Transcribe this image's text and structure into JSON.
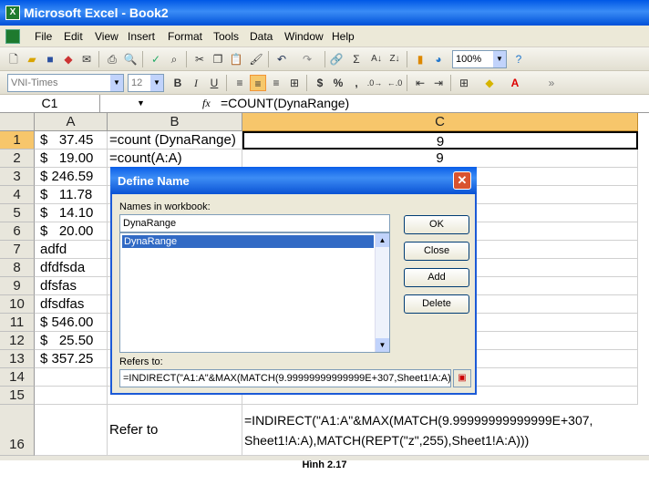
{
  "window": {
    "title": "Microsoft Excel - Book2"
  },
  "menu": [
    "File",
    "Edit",
    "View",
    "Insert",
    "Format",
    "Tools",
    "Data",
    "Window",
    "Help"
  ],
  "toolbar": {
    "zoom": "100%",
    "font": "VNI-Times",
    "font_size": "12",
    "sigma": "Σ",
    "bold": "B",
    "italic": "I",
    "underline": "U",
    "currency": "$",
    "percent": "%",
    "comma": ","
  },
  "formula_bar": {
    "name_box": "C1",
    "fx": "fx",
    "formula": "=COUNT(DynaRange)"
  },
  "columns": [
    "A",
    "B",
    "C"
  ],
  "rows": [
    {
      "n": "1",
      "a": "$   37.45",
      "b": "=count (DynaRange)",
      "c": "9"
    },
    {
      "n": "2",
      "a": "$   19.00",
      "b": "=count(A:A)",
      "c": "9"
    },
    {
      "n": "3",
      "a": "$ 246.59",
      "b": "",
      "c": ""
    },
    {
      "n": "4",
      "a": "$   11.78",
      "b": "",
      "c": ""
    },
    {
      "n": "5",
      "a": "$   14.10",
      "b": "",
      "c": ""
    },
    {
      "n": "6",
      "a": "$   20.00",
      "b": "",
      "c": ""
    },
    {
      "n": "7",
      "a": "adfd",
      "b": "",
      "c": ""
    },
    {
      "n": "8",
      "a": "dfdfsda",
      "b": "",
      "c": ""
    },
    {
      "n": "9",
      "a": "dfsfas",
      "b": "",
      "c": ""
    },
    {
      "n": "10",
      "a": "dfsdfas",
      "b": "",
      "c": ""
    },
    {
      "n": "11",
      "a": "$ 546.00",
      "b": "",
      "c": ""
    },
    {
      "n": "12",
      "a": "$   25.50",
      "b": "",
      "c": ""
    },
    {
      "n": "13",
      "a": "$ 357.25",
      "b": "",
      "c": ""
    },
    {
      "n": "14",
      "a": "",
      "b": "",
      "c": ""
    },
    {
      "n": "15",
      "a": "",
      "b": "",
      "c": ""
    }
  ],
  "row16": {
    "n": "16",
    "b": "Refer to",
    "c_line1": "=INDIRECT(\"A1:A\"&MAX(MATCH(9.99999999999999E+307,",
    "c_line2": "Sheet1!A:A),MATCH(REPT(\"z\",255),Sheet1!A:A)))"
  },
  "dialog": {
    "title": "Define Name",
    "names_label": "Names in workbook:",
    "name_value": "DynaRange",
    "list_items": [
      "DynaRange"
    ],
    "refers_label": "Refers to:",
    "refers_value": "=INDIRECT(\"A1:A\"&MAX(MATCH(9.99999999999999E+307,Sheet1!A:A),M",
    "buttons": {
      "ok": "OK",
      "close": "Close",
      "add": "Add",
      "delete": "Delete"
    }
  },
  "caption": "Hình 2.17",
  "colors": {
    "header_bg": "#e8e6dc",
    "selected_col": "#f7c66b",
    "xp_blue": "#0a5ee8"
  }
}
